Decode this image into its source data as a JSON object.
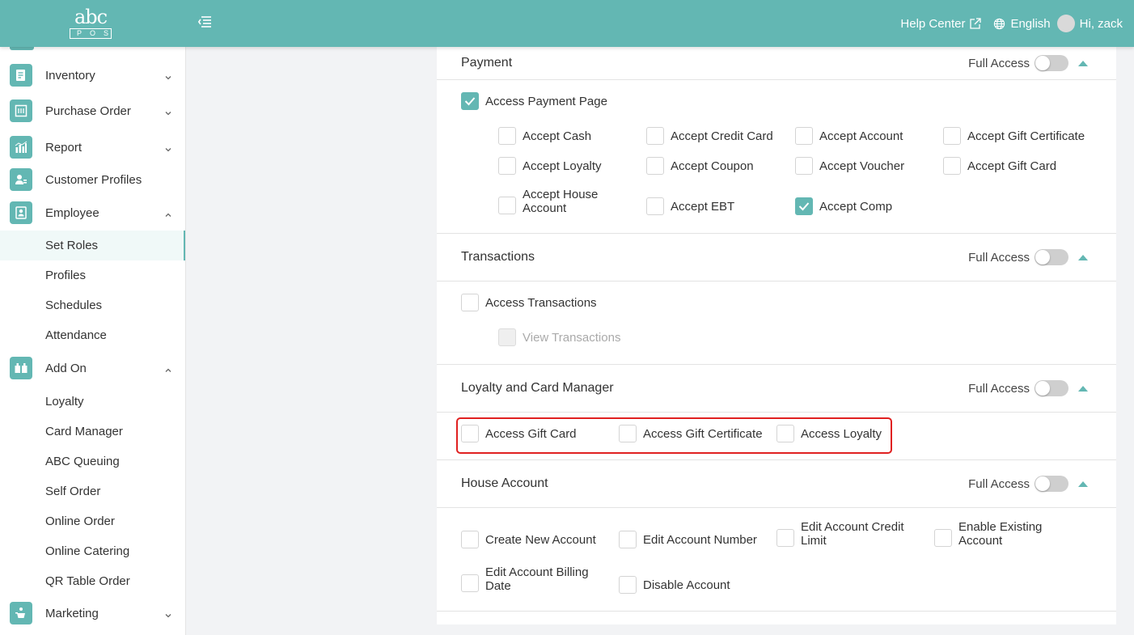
{
  "header": {
    "logo_text": "abc",
    "logo_sub": "POS",
    "help_center": "Help Center",
    "language": "English",
    "greeting": "Hi, zack"
  },
  "sidebar": {
    "items": [
      {
        "label": "Inventory"
      },
      {
        "label": "Purchase Order"
      },
      {
        "label": "Report"
      },
      {
        "label": "Customer Profiles"
      },
      {
        "label": "Employee"
      },
      {
        "label": "Add On"
      },
      {
        "label": "Marketing"
      }
    ],
    "employee_sub": [
      "Set Roles",
      "Profiles",
      "Schedules",
      "Attendance"
    ],
    "addon_sub": [
      "Loyalty",
      "Card Manager",
      "ABC Queuing",
      "Self Order",
      "Online Order",
      "Online Catering",
      "QR Table Order"
    ]
  },
  "full_access_label": "Full Access",
  "sections": {
    "payment": {
      "title": "Payment",
      "main": {
        "label": "Access Payment Page",
        "checked": true
      },
      "options": [
        {
          "label": "Accept Cash",
          "checked": false
        },
        {
          "label": "Accept Credit Card",
          "checked": false
        },
        {
          "label": "Accept Account",
          "checked": false
        },
        {
          "label": "Accept Gift Certificate",
          "checked": false
        },
        {
          "label": "Accept Loyalty",
          "checked": false
        },
        {
          "label": "Accept Coupon",
          "checked": false
        },
        {
          "label": "Accept Voucher",
          "checked": false
        },
        {
          "label": "Accept Gift Card",
          "checked": false
        },
        {
          "label": "Accept House Account",
          "checked": false
        },
        {
          "label": "Accept EBT",
          "checked": false
        },
        {
          "label": "Accept Comp",
          "checked": true
        }
      ]
    },
    "transactions": {
      "title": "Transactions",
      "main": {
        "label": "Access Transactions",
        "checked": false
      },
      "options": [
        {
          "label": "View Transactions",
          "checked": false,
          "disabled": true
        }
      ]
    },
    "loyalty": {
      "title": "Loyalty and Card Manager",
      "options": [
        {
          "label": "Access Gift Card",
          "checked": false
        },
        {
          "label": "Access Gift Certificate",
          "checked": false
        },
        {
          "label": "Access Loyalty",
          "checked": false
        }
      ]
    },
    "house_account": {
      "title": "House Account",
      "options": [
        {
          "label": "Create New Account",
          "checked": false
        },
        {
          "label": "Edit Account Number",
          "checked": false
        },
        {
          "label": "Edit Account Credit Limit",
          "checked": false
        },
        {
          "label": "Enable Existing Account",
          "checked": false
        },
        {
          "label": "Edit Account Billing Date",
          "checked": false
        },
        {
          "label": "Disable Account",
          "checked": false
        }
      ]
    }
  },
  "colors": {
    "accent": "#63b7b3",
    "highlight": "#e02020"
  }
}
